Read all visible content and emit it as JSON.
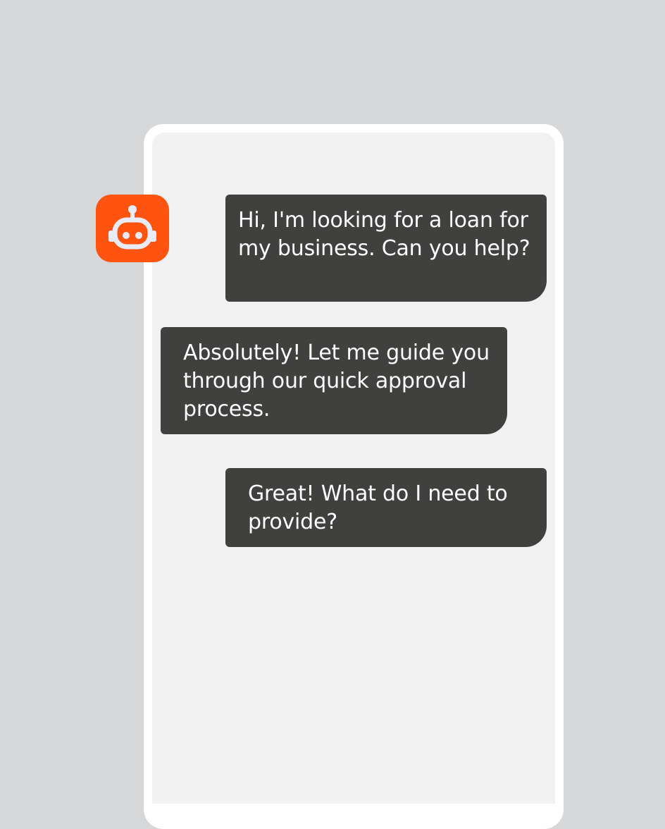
{
  "colors": {
    "background": "#d6d7d9",
    "phone_frame": "#ffffff",
    "screen": "#f1f1f1",
    "bubble": "#40403f",
    "bubble_text": "#ffffff",
    "avatar_bg": "#ff5410",
    "avatar_icon": "#e9ecf6"
  },
  "chat": {
    "avatar_icon": "robot-icon",
    "messages": [
      {
        "sender": "user",
        "text": "Hi, I'm looking for a loan for my business. Can you help?"
      },
      {
        "sender": "bot",
        "text": "Absolutely! Let me guide you through our quick approval process."
      },
      {
        "sender": "user",
        "text": "Great! What do I need to provide?"
      }
    ]
  }
}
